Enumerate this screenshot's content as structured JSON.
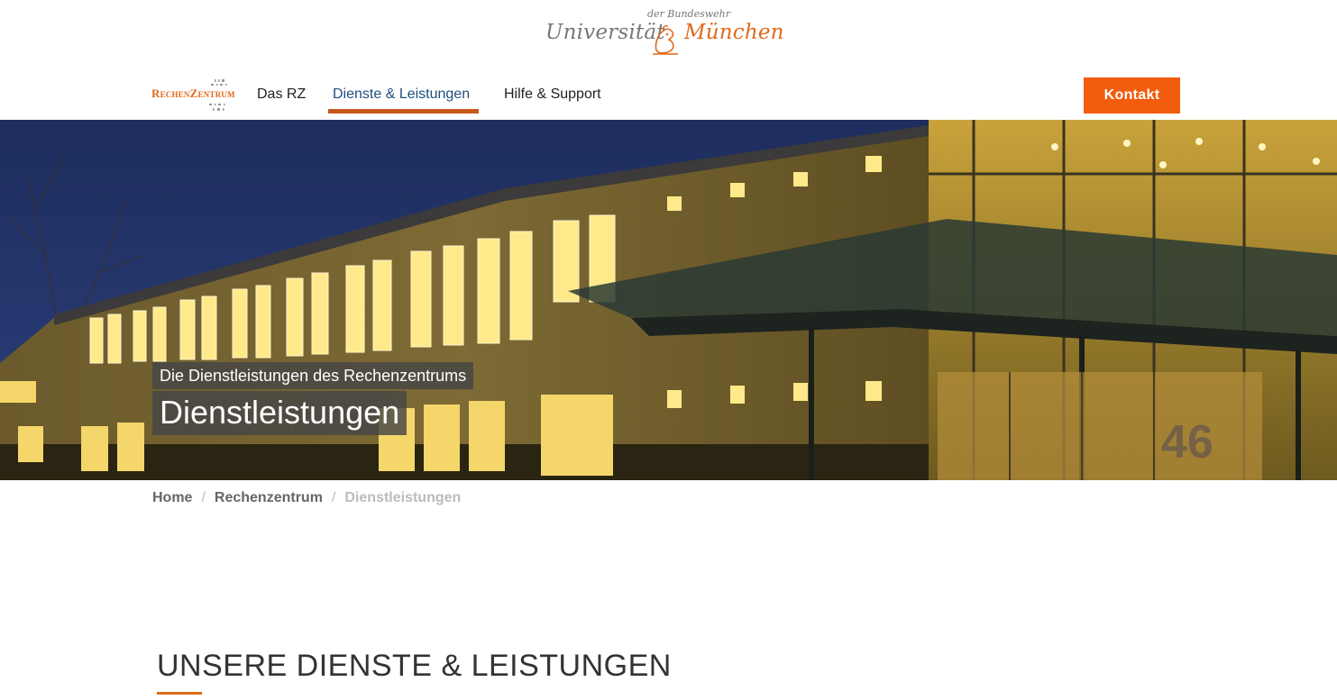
{
  "brand": {
    "uni_small": "der Bundeswehr",
    "uni_left": "Universität",
    "uni_right": "München",
    "rz_logo_part1": "Rechen",
    "rz_logo_part2": "Zentrum"
  },
  "nav": {
    "items": [
      {
        "label": "Das RZ"
      },
      {
        "label": "Dienste & Leistungen",
        "active": true
      },
      {
        "label": "Hilfe & Support"
      }
    ],
    "contact_label": "Kontakt"
  },
  "hero": {
    "subtitle": "Die Dienstleistungen des Rechenzentrums",
    "title": "Dienstleistungen"
  },
  "breadcrumb": {
    "items": [
      "Home",
      "Rechenzentrum"
    ],
    "current": "Dienstleistungen"
  },
  "section": {
    "title": "UNSERE DIENSTE & LEISTUNGEN"
  },
  "colors": {
    "accent": "#f25c0f",
    "nav_active": "#1e4f7c",
    "underline": "#c8581a"
  }
}
